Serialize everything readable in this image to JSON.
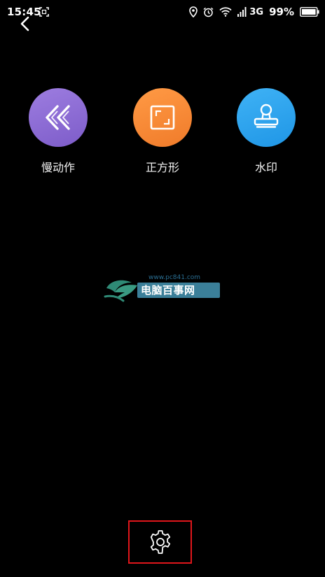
{
  "status_bar": {
    "time": "15:45",
    "network": "3G",
    "battery": "99%",
    "icons": [
      "screenshot-icon",
      "location-icon",
      "alarm-icon",
      "wifi-icon",
      "signal-icon",
      "battery-icon"
    ]
  },
  "nav": {
    "back_icon": "chevron-left-icon"
  },
  "modes": [
    {
      "label": "慢动作",
      "icon": "rewind-icon",
      "color": "#8c6bd6"
    },
    {
      "label": "正方形",
      "icon": "square-crop-icon",
      "color": "#f58a35"
    },
    {
      "label": "水印",
      "icon": "stamp-icon",
      "color": "#2ea4ee"
    }
  ],
  "watermark": {
    "url": "www.pc841.com",
    "text": "电脑百事网"
  },
  "settings": {
    "icon": "gear-icon",
    "highlight_color": "#e0161b"
  }
}
